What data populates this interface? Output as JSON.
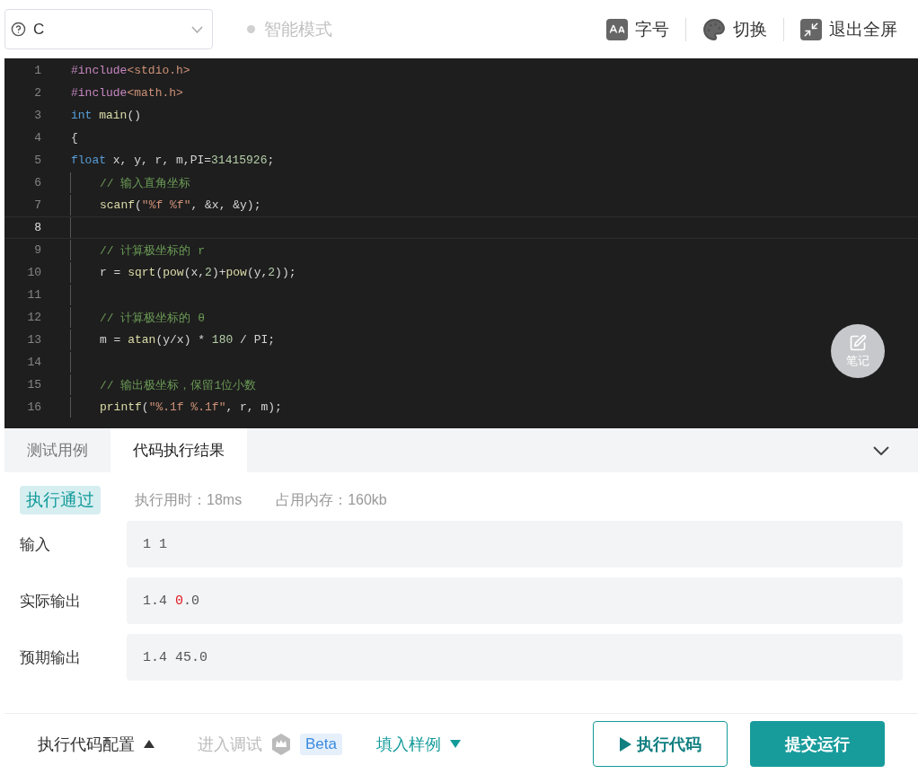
{
  "toolbar": {
    "language": "C",
    "mode": "智能模式",
    "tools": [
      {
        "kind": "font",
        "label": "字号"
      },
      {
        "kind": "theme",
        "label": "切换"
      },
      {
        "kind": "fullscreen",
        "label": "退出全屏"
      }
    ]
  },
  "editor": {
    "lines": [
      {
        "number": "1",
        "current": false,
        "indent": false,
        "tokens": [
          {
            "kind": "preproc",
            "text": "#include"
          },
          {
            "kind": "header",
            "text": "<stdio.h>"
          }
        ]
      },
      {
        "number": "2",
        "current": false,
        "indent": false,
        "tokens": [
          {
            "kind": "preproc",
            "text": "#include"
          },
          {
            "kind": "header",
            "text": "<math.h>"
          }
        ]
      },
      {
        "number": "3",
        "current": false,
        "indent": false,
        "tokens": [
          {
            "kind": "keyword",
            "text": "int"
          },
          {
            "kind": "function",
            "text": " main"
          },
          {
            "kind": "plain",
            "text": "()"
          }
        ]
      },
      {
        "number": "4",
        "current": false,
        "indent": false,
        "tokens": [
          {
            "kind": "plain",
            "text": "{"
          }
        ]
      },
      {
        "number": "5",
        "current": false,
        "indent": false,
        "tokens": [
          {
            "kind": "keyword",
            "text": "float"
          },
          {
            "kind": "plain",
            "text": " x, y, r, m,PI="
          },
          {
            "kind": "number",
            "text": "31415926"
          },
          {
            "kind": "plain",
            "text": ";"
          }
        ]
      },
      {
        "number": "6",
        "current": false,
        "indent": true,
        "tokens": [
          {
            "kind": "comment",
            "text": "// 输入直角坐标"
          }
        ]
      },
      {
        "number": "7",
        "current": false,
        "indent": true,
        "tokens": [
          {
            "kind": "function",
            "text": "scanf"
          },
          {
            "kind": "plain",
            "text": "("
          },
          {
            "kind": "string",
            "text": "\"%f %f\""
          },
          {
            "kind": "plain",
            "text": ", &x, &y);"
          }
        ]
      },
      {
        "number": "8",
        "current": true,
        "indent": true
      },
      {
        "number": "9",
        "current": false,
        "indent": true,
        "tokens": [
          {
            "kind": "comment",
            "text": "// 计算极坐标的 r"
          }
        ]
      },
      {
        "number": "10",
        "current": false,
        "indent": true,
        "tokens": [
          {
            "kind": "plain",
            "text": "r = "
          },
          {
            "kind": "function",
            "text": "sqrt"
          },
          {
            "kind": "plain",
            "text": "("
          },
          {
            "kind": "function",
            "text": "pow"
          },
          {
            "kind": "plain",
            "text": "(x,"
          },
          {
            "kind": "number",
            "text": "2"
          },
          {
            "kind": "plain",
            "text": ")+"
          },
          {
            "kind": "function",
            "text": "pow"
          },
          {
            "kind": "plain",
            "text": "(y,"
          },
          {
            "kind": "number",
            "text": "2"
          },
          {
            "kind": "plain",
            "text": "));"
          }
        ]
      },
      {
        "number": "11",
        "current": false,
        "indent": true
      },
      {
        "number": "12",
        "current": false,
        "indent": true,
        "tokens": [
          {
            "kind": "comment",
            "text": "// 计算极坐标的 θ"
          }
        ]
      },
      {
        "number": "13",
        "current": false,
        "indent": true,
        "tokens": [
          {
            "kind": "plain",
            "text": "m = "
          },
          {
            "kind": "function",
            "text": "atan"
          },
          {
            "kind": "plain",
            "text": "(y/x) * "
          },
          {
            "kind": "number",
            "text": "180"
          },
          {
            "kind": "plain",
            "text": " / PI;"
          }
        ]
      },
      {
        "number": "14",
        "current": false,
        "indent": true
      },
      {
        "number": "15",
        "current": false,
        "indent": true,
        "tokens": [
          {
            "kind": "comment",
            "text": "// 输出极坐标，保留1位小数"
          }
        ]
      },
      {
        "number": "16",
        "current": false,
        "indent": true,
        "tokens": [
          {
            "kind": "function",
            "text": "printf"
          },
          {
            "kind": "plain",
            "text": "("
          },
          {
            "kind": "string",
            "text": "\"%.1f %.1f\""
          },
          {
            "kind": "plain",
            "text": ", r, m);"
          }
        ]
      }
    ],
    "note_button": "笔记"
  },
  "panel": {
    "tabs": [
      {
        "label": "测试用例",
        "selected": false
      },
      {
        "label": "代码执行结果",
        "selected": true
      }
    ],
    "status": "执行通过",
    "time": "执行用时：18ms",
    "memory": "占用内存：160kb",
    "rows": [
      {
        "label": "输入",
        "parts": [
          {
            "text": "1 1",
            "diff": false
          }
        ]
      },
      {
        "label": "实际输出",
        "parts": [
          {
            "text": "1.4 ",
            "diff": false
          },
          {
            "text": "0",
            "diff": true
          },
          {
            "text": ".0",
            "diff": false
          }
        ]
      },
      {
        "label": "预期输出",
        "parts": [
          {
            "text": "1.4 45.0",
            "diff": false
          }
        ]
      }
    ]
  },
  "footer": {
    "config": "执行代码配置",
    "debug": "进入调试",
    "beta": "Beta",
    "sample": "填入样例",
    "run": "执行代码",
    "submit": "提交运行"
  }
}
